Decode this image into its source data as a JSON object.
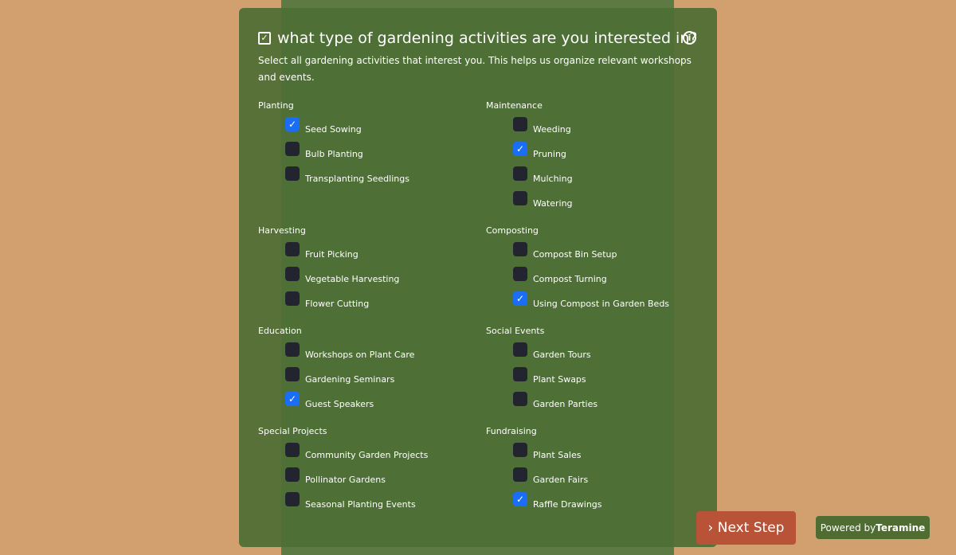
{
  "question": {
    "title": "what type of gardening activities are you interested in?",
    "description": "Select all gardening activities that interest you. This helps us organize relevant workshops and events.",
    "icon": "info-icon"
  },
  "groups": [
    {
      "label": "Planting",
      "items": [
        {
          "label": "Seed Sowing",
          "checked": true
        },
        {
          "label": "Bulb Planting",
          "checked": false
        },
        {
          "label": "Transplanting Seedlings",
          "checked": false
        }
      ]
    },
    {
      "label": "Maintenance",
      "items": [
        {
          "label": "Weeding",
          "checked": false
        },
        {
          "label": "Pruning",
          "checked": true
        },
        {
          "label": "Mulching",
          "checked": false
        },
        {
          "label": "Watering",
          "checked": false
        }
      ]
    },
    {
      "label": "Harvesting",
      "items": [
        {
          "label": "Fruit Picking",
          "checked": false
        },
        {
          "label": "Vegetable Harvesting",
          "checked": false
        },
        {
          "label": "Flower Cutting",
          "checked": false
        }
      ]
    },
    {
      "label": "Composting",
      "items": [
        {
          "label": "Compost Bin Setup",
          "checked": false
        },
        {
          "label": "Compost Turning",
          "checked": false
        },
        {
          "label": "Using Compost in Garden Beds",
          "checked": true
        }
      ]
    },
    {
      "label": "Education",
      "items": [
        {
          "label": "Workshops on Plant Care",
          "checked": false
        },
        {
          "label": "Gardening Seminars",
          "checked": false
        },
        {
          "label": "Guest Speakers",
          "checked": true
        }
      ]
    },
    {
      "label": "Social Events",
      "items": [
        {
          "label": "Garden Tours",
          "checked": false
        },
        {
          "label": "Plant Swaps",
          "checked": false
        },
        {
          "label": "Garden Parties",
          "checked": false
        }
      ]
    },
    {
      "label": "Special Projects",
      "items": [
        {
          "label": "Community Garden Projects",
          "checked": false
        },
        {
          "label": "Pollinator Gardens",
          "checked": false
        },
        {
          "label": "Seasonal Planting Events",
          "checked": false
        }
      ]
    },
    {
      "label": "Fundraising",
      "items": [
        {
          "label": "Plant Sales",
          "checked": false
        },
        {
          "label": "Garden Fairs",
          "checked": false
        },
        {
          "label": "Raffle Drawings",
          "checked": true
        }
      ]
    }
  ],
  "next_button": "Next Step",
  "powered": {
    "prefix": "Powered by",
    "brand": "Teramine"
  },
  "colors": {
    "background": "#d2a06f",
    "panel": "#4e6e35",
    "checked": "#1a6ef5",
    "next": "#b85338"
  }
}
